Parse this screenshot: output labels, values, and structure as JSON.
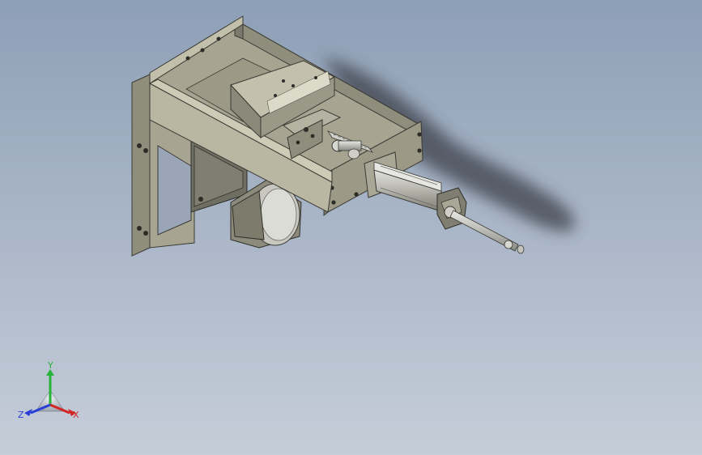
{
  "viewport": {
    "model_name": "cylinder-slide-mechanism",
    "colors": {
      "background_top": "#8d9fb6",
      "background_bottom": "#c5cdd8",
      "metal_light": "#b9b6a2",
      "metal_mid": "#9c9a87",
      "metal_dark": "#6f6e62",
      "steel": "#c8c8c4",
      "shadow": "#3c4048"
    }
  },
  "triad": {
    "x_label": "X",
    "y_label": "Y",
    "z_label": "Z",
    "x_color": "#d42424",
    "y_color": "#27b33a",
    "z_color": "#2a3fd6"
  }
}
